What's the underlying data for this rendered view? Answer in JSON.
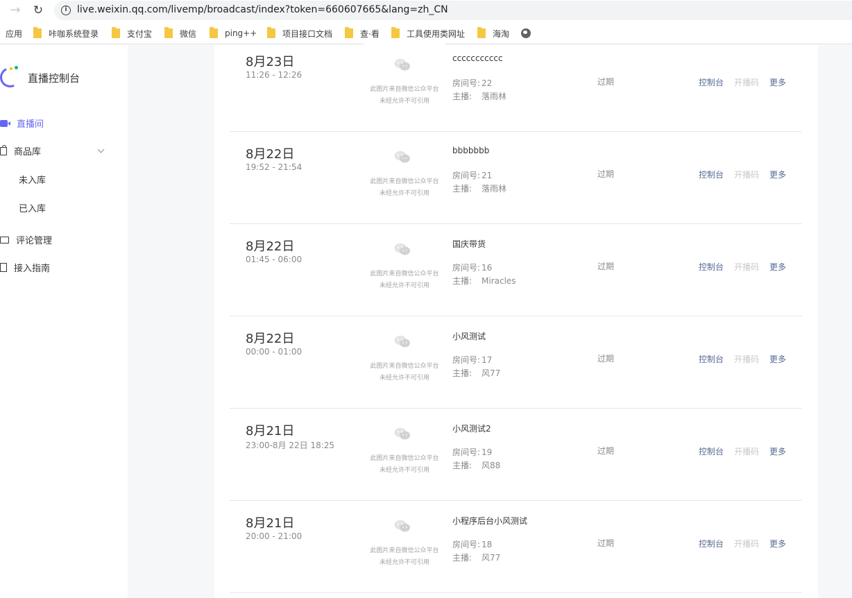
{
  "browser": {
    "url": "live.weixin.qq.com/livemp/broadcast/index?token=660607665&lang=zh_CN",
    "apps_label": "应用",
    "bookmarks": [
      "咔咖系统登录",
      "支付宝",
      "微信",
      "ping++",
      "项目接口文档",
      "查·看",
      "工具使用类网址",
      "海淘"
    ]
  },
  "sidebar": {
    "title": "直播控制台",
    "items": [
      {
        "label": "直播间"
      },
      {
        "label": "商品库"
      },
      {
        "label": "评论管理"
      },
      {
        "label": "接入指南"
      }
    ],
    "sub_items": [
      "未入库",
      "已入库"
    ]
  },
  "thumb_caption": {
    "line1": "此图片来自微信公众平台",
    "line2": "未经允许不可引用"
  },
  "labels": {
    "room": "房间号:",
    "host": "主播:",
    "console": "控制台",
    "code": "开播码",
    "more": "更多"
  },
  "rows": [
    {
      "date": "8月23日",
      "time": "11:26 - 12:26",
      "title": "ccccccccccc",
      "room": "22",
      "host": "落雨林",
      "status": "过期"
    },
    {
      "date": "8月22日",
      "time": "19:52 - 21:54",
      "title": "bbbbbbb",
      "room": "21",
      "host": "落雨林",
      "status": "过期"
    },
    {
      "date": "8月22日",
      "time": "01:45 - 06:00",
      "title": "国庆带货",
      "room": "16",
      "host": "Miracles",
      "status": "过期"
    },
    {
      "date": "8月22日",
      "time": "00:00 - 01:00",
      "title": "小风测试",
      "room": "17",
      "host": "风77",
      "status": "过期"
    },
    {
      "date": "8月21日",
      "time": "23:00-8月 22日 18:25",
      "title": "小风测试2",
      "room": "19",
      "host": "风88",
      "status": "过期"
    },
    {
      "date": "8月21日",
      "time": "20:00 - 21:00",
      "title": "小程序后台小风测试",
      "room": "18",
      "host": "风77",
      "status": "过期"
    }
  ]
}
